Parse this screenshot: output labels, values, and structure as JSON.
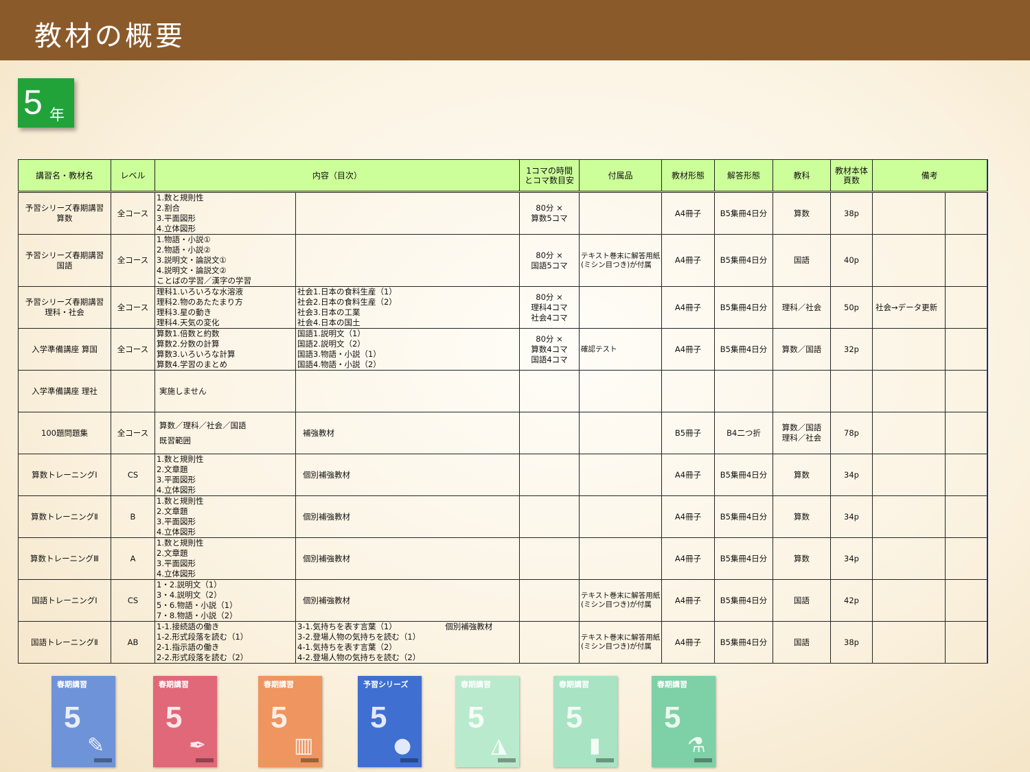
{
  "header": {
    "title": "教材の概要"
  },
  "grade": {
    "number": "5",
    "unit": "年"
  },
  "table": {
    "headers": {
      "name": "講習名・教材名",
      "level": "レベル",
      "contents": "内容（目次）",
      "time_l1": "1コマの時間",
      "time_l2": "とコマ数目安",
      "attach": "付属品",
      "format": "教材形態",
      "answer": "解答形態",
      "subject": "教科",
      "pages_l1": "教材本体",
      "pages_l2": "頁数",
      "remarks": "備考"
    },
    "rows": [
      {
        "name": [
          "予習シリーズ春期講習",
          "算数"
        ],
        "level": "全コース",
        "c1": [
          "1.数と規則性",
          "2.割合",
          "3.平面図形",
          "4.立体図形"
        ],
        "c2": [],
        "time": [
          "80分 ×",
          "算数5コマ"
        ],
        "attach": [],
        "format": "A4冊子",
        "answer": "B5集冊4日分",
        "subject": [
          "算数"
        ],
        "pages": "38p",
        "remarks": ""
      },
      {
        "name": [
          "予習シリーズ春期講習",
          "国語"
        ],
        "level": "全コース",
        "c1": [
          "1.物語・小説①",
          "2.物語・小説②",
          "3.説明文・論説文①",
          "4.説明文・論説文②",
          "ことばの学習／漢字の学習"
        ],
        "c2": [],
        "time": [
          "80分 ×",
          "国語5コマ"
        ],
        "attach": [
          "テキスト巻末に解答用紙",
          "(ミシン目つき)が付属"
        ],
        "format": "A4冊子",
        "answer": "B5集冊4日分",
        "subject": [
          "国語"
        ],
        "pages": "40p",
        "remarks": ""
      },
      {
        "name": [
          "予習シリーズ春期講習",
          "理科・社会"
        ],
        "level": "全コース",
        "c1": [
          "理科1.いろいろな水溶液",
          "理科2.物のあたたまり方",
          "理科3.星の動き",
          "理科4.天気の変化"
        ],
        "c2": [
          "社会1.日本の食料生産（1）",
          "社会2.日本の食料生産（2）",
          "社会3.日本の工業",
          "社会4.日本の国土"
        ],
        "time": [
          "80分 ×",
          "理科4コマ",
          "社会4コマ"
        ],
        "attach": [],
        "format": "A4冊子",
        "answer": "B5集冊4日分",
        "subject": [
          "理科／社会"
        ],
        "pages": "50p",
        "remarks": "社会→データ更新"
      },
      {
        "name": [
          "入学準備講座 算国"
        ],
        "level": "全コース",
        "c1": [
          "算数1.倍数と約数",
          "算数2.分数の計算",
          "算数3.いろいろな計算",
          "算数4.学習のまとめ"
        ],
        "c2": [
          "国語1.説明文（1）",
          "国語2.説明文（2）",
          "国語3.物語・小説（1）",
          "国語4.物語・小説（2）"
        ],
        "time": [
          "80分 ×",
          "算数4コマ",
          "国語4コマ"
        ],
        "attach": [
          "確認テスト"
        ],
        "format": "A4冊子",
        "answer": "B5集冊4日分",
        "subject": [
          "算数／国語"
        ],
        "pages": "32p",
        "remarks": ""
      },
      {
        "name": [
          "入学準備講座 理社"
        ],
        "level": "",
        "c1": [
          "実施しません"
        ],
        "c2": [],
        "time": [],
        "attach": [],
        "format": "",
        "answer": "",
        "subject": [],
        "pages": "",
        "remarks": ""
      },
      {
        "name": [
          "100題問題集"
        ],
        "level": "全コース",
        "c1": [
          "算数／理科／社会／国語",
          "既習範囲"
        ],
        "c2": [
          "補強教材"
        ],
        "time": [],
        "attach": [],
        "format": "B5冊子",
        "answer": "B4二つ折",
        "subject": [
          "算数／国語",
          "理科／社会"
        ],
        "pages": "78p",
        "remarks": ""
      },
      {
        "name": [
          "算数トレーニングⅠ"
        ],
        "level": "CS",
        "c1": [
          "1.数と規則性",
          "2.文章題",
          "3.平面図形",
          "4.立体図形"
        ],
        "c2": [
          "個別補強教材"
        ],
        "time": [],
        "attach": [],
        "format": "A4冊子",
        "answer": "B5集冊4日分",
        "subject": [
          "算数"
        ],
        "pages": "34p",
        "remarks": ""
      },
      {
        "name": [
          "算数トレーニングⅡ"
        ],
        "level": "B",
        "c1": [
          "1.数と規則性",
          "2.文章題",
          "3.平面図形",
          "4.立体図形"
        ],
        "c2": [
          "個別補強教材"
        ],
        "time": [],
        "attach": [],
        "format": "A4冊子",
        "answer": "B5集冊4日分",
        "subject": [
          "算数"
        ],
        "pages": "34p",
        "remarks": ""
      },
      {
        "name": [
          "算数トレーニングⅢ"
        ],
        "level": "A",
        "c1": [
          "1.数と規則性",
          "2.文章題",
          "3.平面図形",
          "4.立体図形"
        ],
        "c2": [
          "個別補強教材"
        ],
        "time": [],
        "attach": [],
        "format": "A4冊子",
        "answer": "B5集冊4日分",
        "subject": [
          "算数"
        ],
        "pages": "34p",
        "remarks": ""
      },
      {
        "name": [
          "国語トレーニングⅠ"
        ],
        "level": "CS",
        "c1": [
          "1・2.説明文（1）",
          "3・4.説明文（2）",
          "5・6.物語・小説（1）",
          "7・8.物語・小説（2）"
        ],
        "c2": [
          "個別補強教材"
        ],
        "time": [],
        "attach": [
          "テキスト巻末に解答用紙",
          "(ミシン目つき)が付属"
        ],
        "format": "A4冊子",
        "answer": "B5集冊4日分",
        "subject": [
          "国語"
        ],
        "pages": "42p",
        "remarks": ""
      },
      {
        "name": [
          "国語トレーニングⅡ"
        ],
        "level": "AB",
        "c1": [
          "1-1.接続語の働き",
          "1-2.形式段落を読む（1）",
          "2-1.指示語の働き",
          "2-2.形式段落を読む（2）"
        ],
        "c2": [
          "3-1.気持ちを表す言葉（1）",
          "3-2.登場人物の気持ちを読む（1）",
          "4-1.気持ちを表す言葉（2）",
          "4-2.登場人物の気持ちを読む（2）"
        ],
        "c2b": "個別補強教材",
        "time": [],
        "attach": [
          "テキスト巻末に解答用紙",
          "(ミシン目つき)が付属"
        ],
        "format": "A4冊子",
        "answer": "B5集冊4日分",
        "subject": [
          "国語"
        ],
        "pages": "38p",
        "remarks": ""
      }
    ]
  },
  "books": [
    {
      "label": "春期講習",
      "num": "5",
      "color": "#6f93d8",
      "icon": "pencil-icon"
    },
    {
      "label": "春期講習",
      "num": "5",
      "color": "#e06878",
      "icon": "pen-icon"
    },
    {
      "label": "春期講習",
      "num": "5",
      "color": "#ee9560",
      "icon": "chart-icon"
    },
    {
      "label": "予習シリーズ",
      "num": "5",
      "color": "#3f6fd0",
      "icon": "beads-icon"
    },
    {
      "label": "春期講習",
      "num": "5",
      "color": "#b9eacd",
      "icon": "triangle-icon"
    },
    {
      "label": "春期講習",
      "num": "5",
      "color": "#a8e3c4",
      "icon": "book-icon"
    },
    {
      "label": "春期講習",
      "num": "5",
      "color": "#7ed0a6",
      "icon": "flask-icon"
    }
  ]
}
